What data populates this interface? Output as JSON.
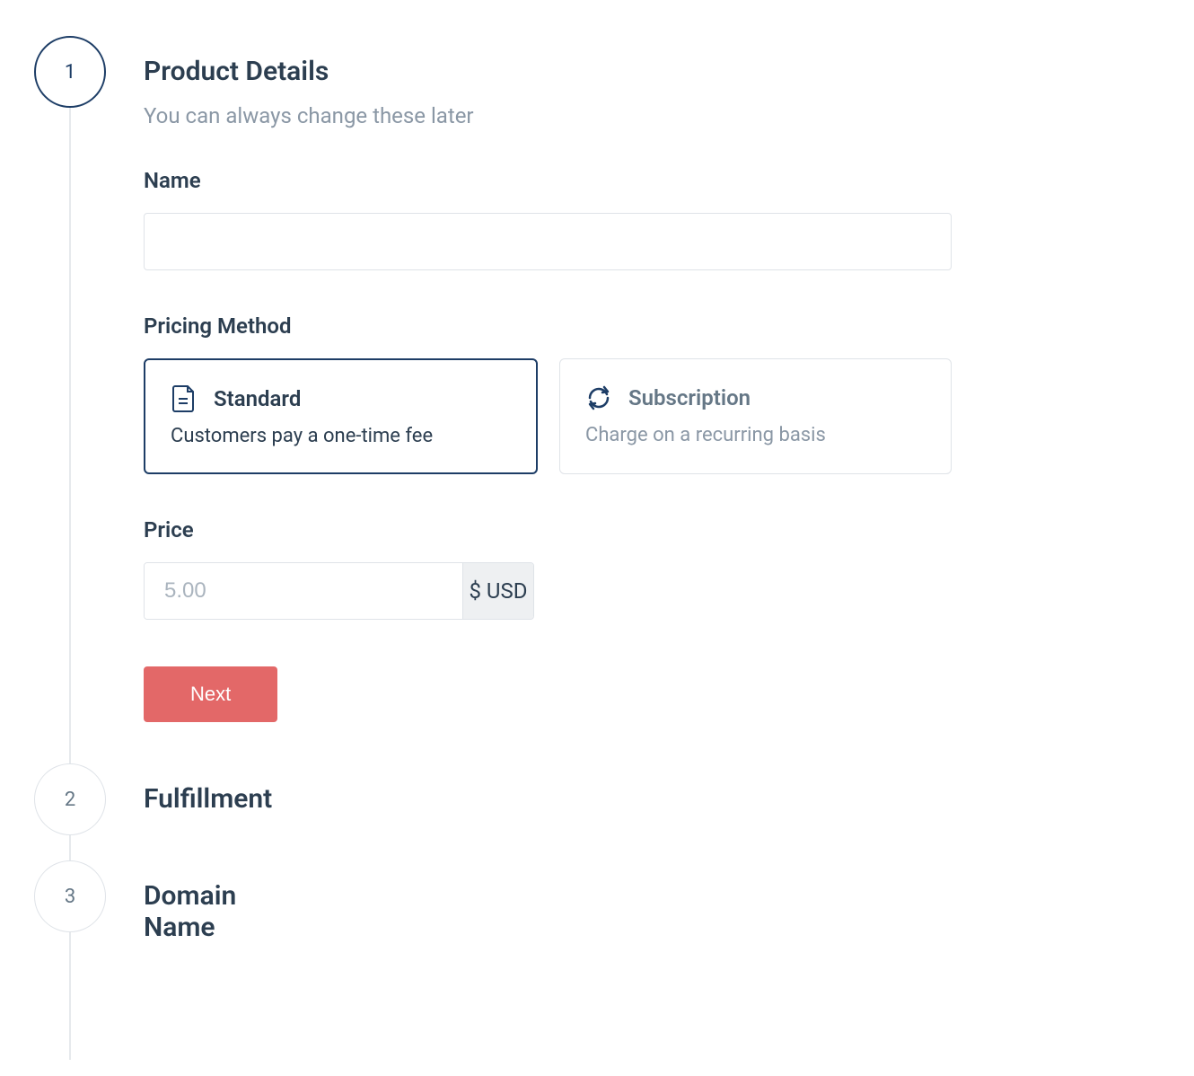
{
  "steps": {
    "step1": {
      "number": "1",
      "title": "Product Details",
      "subtitle": "You can always change these later"
    },
    "step2": {
      "number": "2",
      "title": "Fulfillment"
    },
    "step3": {
      "number": "3",
      "title": "Domain Name"
    }
  },
  "form": {
    "name_label": "Name",
    "name_value": "",
    "pricing_method_label": "Pricing Method",
    "price_label": "Price",
    "price_placeholder": "5.00",
    "price_suffix": "$ USD",
    "next_button": "Next"
  },
  "pricing_options": {
    "standard": {
      "title": "Standard",
      "description": "Customers pay a one-time fee"
    },
    "subscription": {
      "title": "Subscription",
      "description": "Charge on a recurring basis"
    }
  }
}
